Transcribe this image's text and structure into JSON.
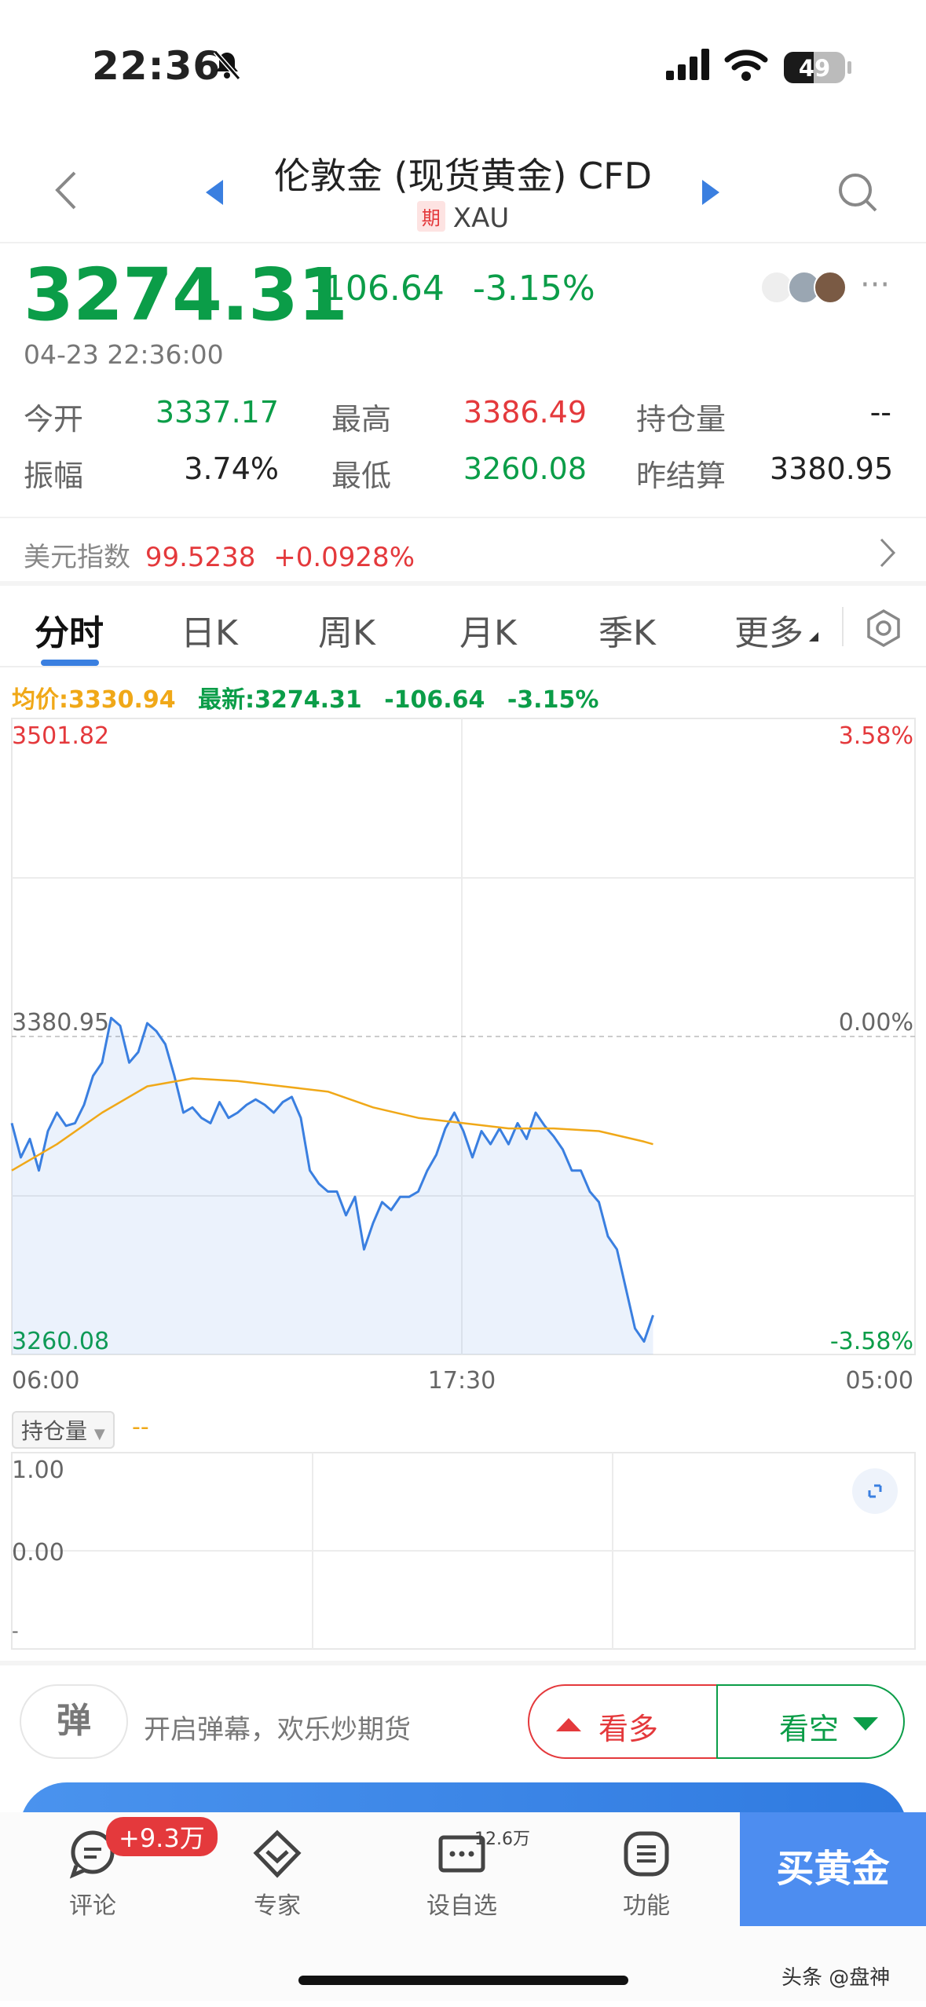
{
  "status": {
    "time": "22:36",
    "battery": "49",
    "battery_level": 0.49
  },
  "nav": {
    "title": "伦敦金 (现货黄金) CFD",
    "tag": "期",
    "symbol": "XAU"
  },
  "quote": {
    "price": "3274.31",
    "change": "-106.64",
    "change_pct": "-3.15%",
    "timestamp": "04-23 22:36:00",
    "stats": [
      {
        "label": "今开",
        "value": "3337.17"
      },
      {
        "label": "最高",
        "value": "3386.49"
      },
      {
        "label": "持仓量",
        "value": "--"
      },
      {
        "label": "振幅",
        "value": "3.74%"
      },
      {
        "label": "最低",
        "value": "3260.08"
      },
      {
        "label": "昨结算",
        "value": "3380.95"
      }
    ]
  },
  "usd_index": {
    "label": "美元指数",
    "value": "99.5238",
    "change": "+0.0928%"
  },
  "tabs": [
    "分时",
    "日K",
    "周K",
    "月K",
    "季K",
    "更多"
  ],
  "legend": {
    "avg": "均价:3330.94",
    "latest": "最新:3274.31",
    "change": "-106.64",
    "pct": "-3.15%"
  },
  "chart_data": {
    "type": "line",
    "y_top_label": "3501.82",
    "y_mid_label": "3380.95",
    "y_bottom_label": "3260.08",
    "pct_top": "3.58%",
    "pct_mid": "0.00%",
    "pct_bottom": "-3.58%",
    "x_labels": [
      "06:00",
      "17:30",
      "05:00"
    ],
    "ylim": [
      3260.08,
      3501.82
    ],
    "series": [
      {
        "name": "最新",
        "color": "#3a7fe0",
        "x": [
          0,
          0.01,
          0.02,
          0.03,
          0.04,
          0.05,
          0.06,
          0.07,
          0.08,
          0.09,
          0.1,
          0.11,
          0.12,
          0.13,
          0.14,
          0.15,
          0.16,
          0.17,
          0.18,
          0.19,
          0.2,
          0.21,
          0.22,
          0.23,
          0.24,
          0.25,
          0.26,
          0.27,
          0.28,
          0.29,
          0.3,
          0.31,
          0.32,
          0.33,
          0.34,
          0.35,
          0.36,
          0.37,
          0.38,
          0.39,
          0.4,
          0.41,
          0.42,
          0.43,
          0.44,
          0.45,
          0.46,
          0.47,
          0.48,
          0.49,
          0.5,
          0.51,
          0.52,
          0.53,
          0.54,
          0.55,
          0.56,
          0.57,
          0.58,
          0.59,
          0.6,
          0.61,
          0.62,
          0.63,
          0.64,
          0.65,
          0.66,
          0.67,
          0.68,
          0.69,
          0.7,
          0.71
        ],
        "y": [
          3348,
          3335,
          3342,
          3330,
          3345,
          3352,
          3347,
          3348,
          3355,
          3366,
          3371,
          3388,
          3385,
          3371,
          3375,
          3386,
          3383,
          3378,
          3366,
          3352,
          3354,
          3350,
          3348,
          3356,
          3350,
          3352,
          3355,
          3357,
          3355,
          3352,
          3356,
          3358,
          3350,
          3330,
          3325,
          3322,
          3322,
          3313,
          3320,
          3300,
          3310,
          3318,
          3315,
          3320,
          3320,
          3322,
          3330,
          3336,
          3346,
          3352,
          3345,
          3335,
          3345,
          3340,
          3346,
          3340,
          3348,
          3342,
          3352,
          3347,
          3343,
          3338,
          3330,
          3330,
          3322,
          3318,
          3305,
          3300,
          3285,
          3270,
          3265,
          3275
        ]
      },
      {
        "name": "均价",
        "color": "#f0a818",
        "x": [
          0,
          0.05,
          0.1,
          0.15,
          0.2,
          0.25,
          0.3,
          0.35,
          0.4,
          0.45,
          0.5,
          0.55,
          0.6,
          0.65,
          0.7,
          0.71
        ],
        "y": [
          3330,
          3340,
          3352,
          3362,
          3365,
          3364,
          3362,
          3360,
          3354,
          3350,
          3348,
          3346,
          3346,
          3345,
          3341,
          3340
        ]
      }
    ]
  },
  "oi_panel": {
    "selector": "持仓量",
    "value": "--",
    "ticks": [
      "1.00",
      "0.00",
      "-"
    ]
  },
  "bottom": {
    "danmu_icon": "弹",
    "danmu_text": "开启弹幕，欢乐炒期货",
    "long": "看多",
    "short": "看空"
  },
  "tabbar": {
    "items": [
      "评论",
      "专家",
      "设自选",
      "功能"
    ],
    "badge": "+9.3万",
    "fav_count": "12.6万",
    "buy": "买黄金"
  },
  "watermark": "头条 @盘神",
  "colors": {
    "down": "#0b9d48",
    "up": "#e4393c",
    "accent": "#3a7fe0",
    "avg": "#f0a818"
  }
}
